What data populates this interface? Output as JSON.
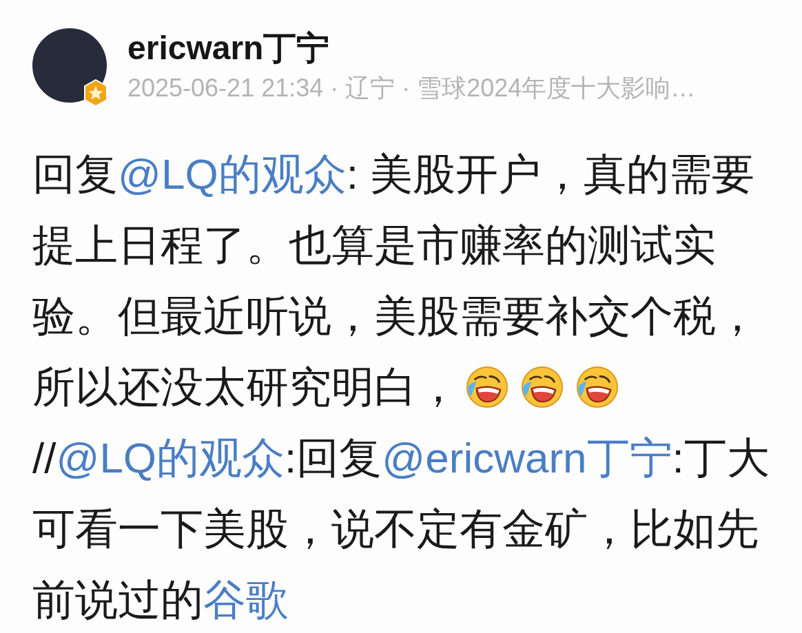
{
  "post": {
    "author": {
      "name": "ericwarn丁宁",
      "meta": "2025-06-21 21:34 · 辽宁 · 雪球2024年度十大影响…"
    },
    "body": [
      {
        "kind": "text",
        "text": "回复"
      },
      {
        "kind": "mention",
        "text": "@LQ的观众"
      },
      {
        "kind": "text",
        "text": ": 美股开户，真的需要提上日程了。也算是市赚率的测试实验。但最近听说，美股需要补交个税，所以还没太研究明白，"
      },
      {
        "kind": "emoji"
      },
      {
        "kind": "emoji"
      },
      {
        "kind": "emoji"
      },
      {
        "kind": "text",
        "text": "//"
      },
      {
        "kind": "mention",
        "text": "@LQ的观众"
      },
      {
        "kind": "text",
        "text": ":回复"
      },
      {
        "kind": "mention",
        "text": "@ericwarn丁宁"
      },
      {
        "kind": "text",
        "text": ":丁大可看一下美股，说不定有金矿，比如先前说过的"
      },
      {
        "kind": "stock",
        "text": "谷歌"
      }
    ]
  }
}
